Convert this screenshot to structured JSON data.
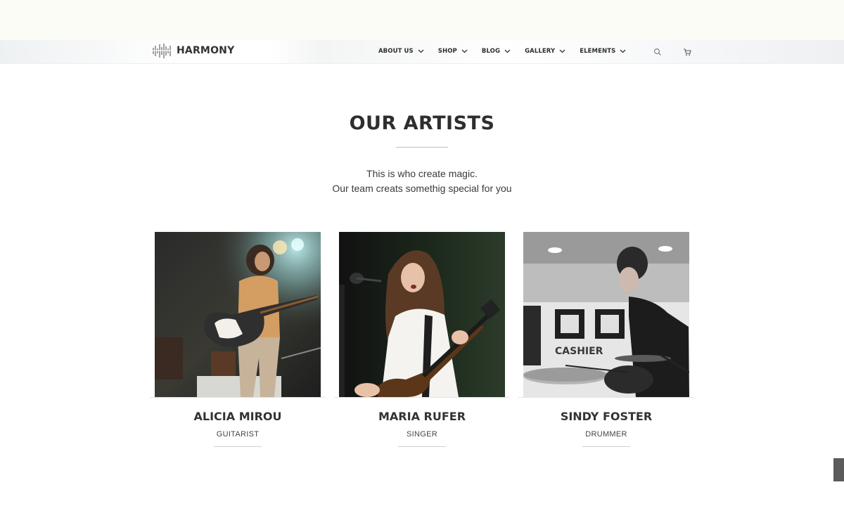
{
  "brand": {
    "name": "HARMONY"
  },
  "nav": {
    "items": [
      {
        "label": "ABOUT US"
      },
      {
        "label": "SHOP"
      },
      {
        "label": "BLOG"
      },
      {
        "label": "GALLERY"
      },
      {
        "label": "ELEMENTS"
      }
    ],
    "icons": [
      "search-icon",
      "cart-icon"
    ]
  },
  "section": {
    "title": "OUR ARTISTS",
    "intro_line1": "This is who create magic.",
    "intro_line2": "Our team creats somethig special for you"
  },
  "artists": [
    {
      "name": "ALICIA MIROU",
      "role": "GUITARIST"
    },
    {
      "name": "MARIA RUFER",
      "role": "SINGER"
    },
    {
      "name": "SINDY FOSTER",
      "role": "DRUMMER",
      "photo_sign": "CASHIER"
    }
  ],
  "colors": {
    "text_dark": "#2e2e2e",
    "top_band": "#fcfcf7",
    "scroll_button": "#5b5b5b"
  }
}
